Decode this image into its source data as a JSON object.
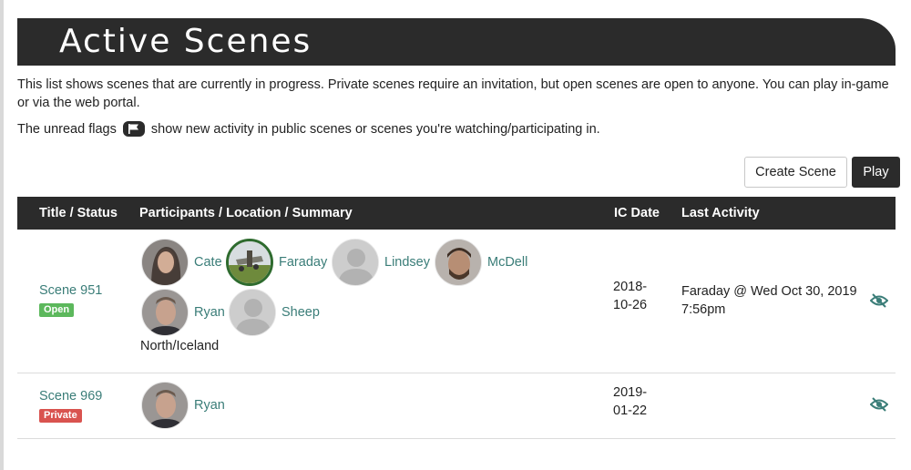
{
  "page": {
    "title": "Active Scenes",
    "intro": "This list shows scenes that are currently in progress. Private scenes require an invitation, but open scenes are open to anyone. You can play in-game or via the web portal.",
    "flag_before": "The unread flags",
    "flag_after": "show new activity in public scenes or scenes you're watching/participating in."
  },
  "actions": {
    "create_label": "Create Scene",
    "play_label": "Play"
  },
  "table": {
    "headers": [
      "Title / Status",
      "Participants / Location / Summary",
      "IC Date",
      "Last Activity"
    ],
    "rows": [
      {
        "title": "Scene 951",
        "status": "Open",
        "participants": [
          "Cate",
          "Faraday",
          "Lindsey",
          "McDell",
          "Ryan",
          "Sheep"
        ],
        "location": "North/Iceland",
        "ic_date_line1": "2018-",
        "ic_date_line2": "10-26",
        "last_activity_line1": "Faraday @ Wed Oct 30, 2019",
        "last_activity_line2": "7:56pm"
      },
      {
        "title": "Scene 969",
        "status": "Private",
        "participants": [
          "Ryan"
        ],
        "location": "",
        "ic_date_line1": "2019-",
        "ic_date_line2": "01-22",
        "last_activity_line1": "",
        "last_activity_line2": ""
      }
    ]
  },
  "colors": {
    "dark": "#2b2b2b",
    "link": "#3a7d78",
    "open": "#5cb85c",
    "private": "#d9534f"
  },
  "icons": {
    "unread_flag": "flag-icon",
    "watch": "eye-slash-icon"
  }
}
